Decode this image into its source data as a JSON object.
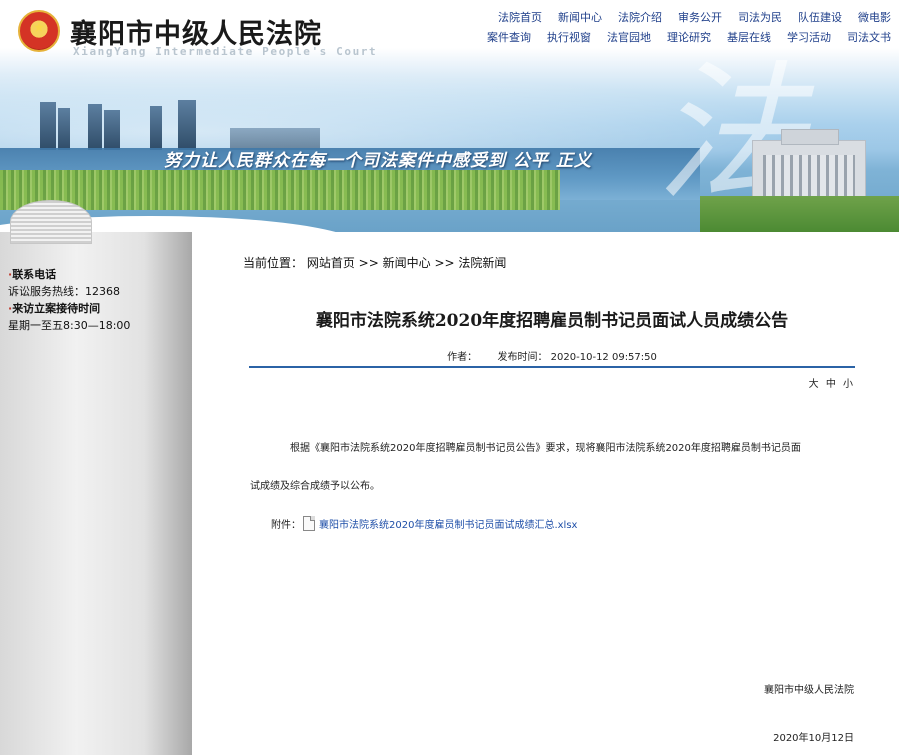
{
  "header": {
    "court_name": "襄阳市中级人民法院",
    "court_name_en": "XiangYang Intermediate People's Court",
    "slogan": "努力让人民群众在每一个司法案件中感受到  公平 正义",
    "banner_char": "法",
    "nav_row1": [
      "法院首页",
      "新闻中心",
      "法院介绍",
      "审务公开",
      "司法为民",
      "队伍建设",
      "微电影"
    ],
    "nav_row2": [
      "案件查询",
      "执行视窗",
      "法官园地",
      "理论研究",
      "基层在线",
      "学习活动",
      "司法文书"
    ]
  },
  "sidebar": {
    "contact_heading": "联系电话",
    "hotline": "诉讼服务热线：12368",
    "reception_heading": "来访立案接待时间",
    "reception_hours": "星期一至五8:30—18:00"
  },
  "breadcrumb": {
    "prefix": "当前位置：",
    "home": "网站首页",
    "sep1": " >> ",
    "news": "新闻中心",
    "sep2": " >> ",
    "current": "法院新闻"
  },
  "article": {
    "title": "襄阳市法院系统2020年度招聘雇员制书记员面试人员成绩公告",
    "author_label": "作者：",
    "publish_label": "发布时间：",
    "publish_time": "2020-10-12 09:57:50",
    "font_large": "大",
    "font_medium": "中",
    "font_small": "小",
    "paragraph1": "根据《襄阳市法院系统2020年度招聘雇员制书记员公告》要求，现将襄阳市法院系统2020年度招聘雇员制书记员面",
    "paragraph2": "试成绩及综合成绩予以公布。",
    "attachment_label": "附件：",
    "attachment_name": "襄阳市法院系统2020年度雇员制书记员面试成绩汇总.xlsx",
    "signature": "襄阳市中级人民法院",
    "date": "2020年10月12日"
  }
}
